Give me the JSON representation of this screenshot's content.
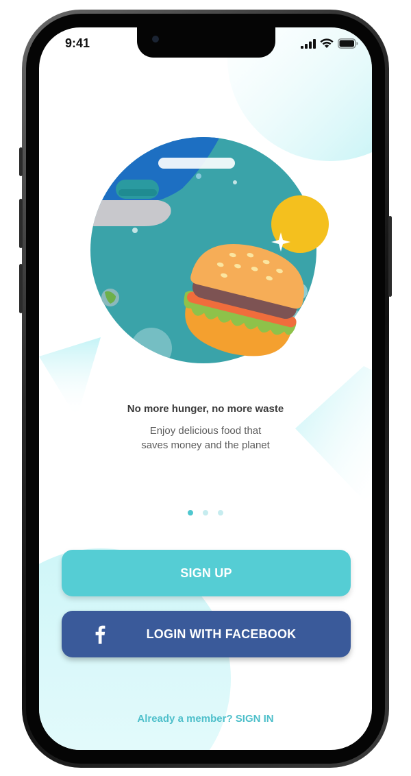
{
  "status_bar": {
    "time": "9:41",
    "icons": [
      "cellular-signal-icon",
      "wifi-icon",
      "battery-icon"
    ]
  },
  "hero": {
    "illustration": "burger-planet-illustration"
  },
  "onboarding": {
    "headline": "No more hunger, no more waste",
    "subline_1": "Enjoy delicious food that",
    "subline_2": "saves money and the planet",
    "page_count": 3,
    "active_page": 1
  },
  "actions": {
    "signup_label": "SIGN UP",
    "facebook_label": "LOGIN WITH FACEBOOK",
    "facebook_icon": "facebook-icon",
    "signin_text": "Already a member? SIGN IN"
  },
  "colors": {
    "accent_teal": "#55cdd4",
    "facebook_blue": "#3a5a9a",
    "signin_text": "#4ebfca",
    "planet_teal": "#3aa3a9",
    "sun_yellow": "#f4c01e"
  }
}
